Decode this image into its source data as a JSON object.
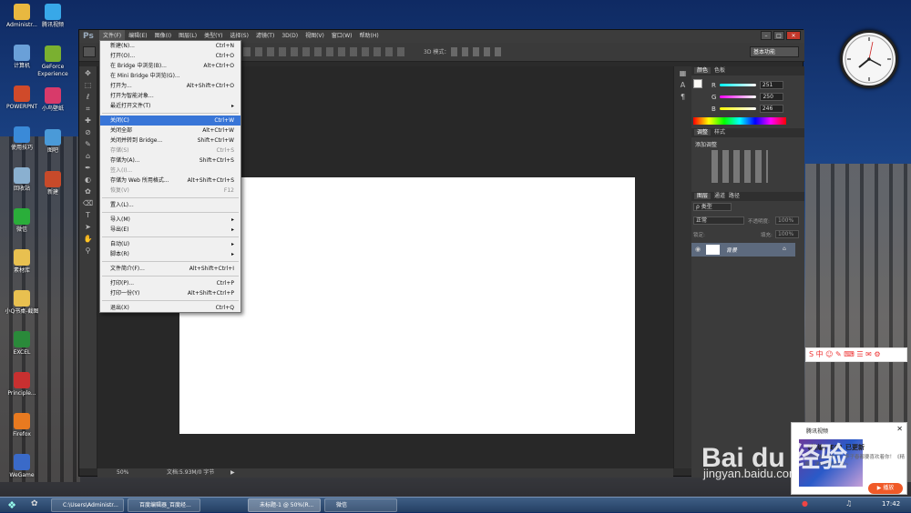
{
  "desktop": {
    "icons": [
      {
        "label": "Administr...",
        "color": "#e8b840"
      },
      {
        "label": "计算机",
        "color": "#6aa0d8"
      },
      {
        "label": "POWERPNT",
        "color": "#d04a2a"
      },
      {
        "label": "使用技巧",
        "color": "#3a8ad8"
      },
      {
        "label": "回收站",
        "color": "#8ab0d0"
      },
      {
        "label": "微信",
        "color": "#2aae3a"
      },
      {
        "label": "素材库",
        "color": "#e8c050"
      },
      {
        "label": "小Q书桌-截图",
        "color": "#e8c050"
      },
      {
        "label": "EXCEL",
        "color": "#2a8a3a"
      },
      {
        "label": "Principle...",
        "color": "#c83030"
      },
      {
        "label": "Firefox",
        "color": "#e87a20"
      },
      {
        "label": "WeGame",
        "color": "#3a6ac8"
      }
    ],
    "icons_col2": [
      {
        "label": "腾讯视频",
        "color": "#38a8e8"
      },
      {
        "label": "GeForce Experience",
        "color": "#7ab030"
      },
      {
        "label": "小鸟壁纸",
        "color": "#d83a6a"
      },
      {
        "label": "图吧",
        "color": "#4a9ad8"
      },
      {
        "label": "新建",
        "color": "#c84a2a"
      }
    ]
  },
  "ps": {
    "logo": "Ps",
    "menus": [
      "文件(F)",
      "编辑(E)",
      "图像(I)",
      "图层(L)",
      "类型(Y)",
      "选择(S)",
      "滤镜(T)",
      "3D(D)",
      "视图(V)",
      "窗口(W)",
      "帮助(H)"
    ],
    "workspace": "基本功能",
    "options_3d": "3D 模式：",
    "status_zoom": "50%",
    "status_doc": "文档:5.93M/0 字节",
    "panels": {
      "color_tabs": [
        "颜色",
        "色板"
      ],
      "rgb": [
        {
          "label": "R",
          "value": "251"
        },
        {
          "label": "G",
          "value": "250"
        },
        {
          "label": "B",
          "value": "246"
        }
      ],
      "adjust_tabs": [
        "调整",
        "样式"
      ],
      "adjust_title": "添加调整",
      "layers_tabs": [
        "图层",
        "通道",
        "路径"
      ],
      "layer_kind": "ρ 类型",
      "blend_mode": "正常",
      "opacity_label": "不透明度:",
      "opacity_value": "100%",
      "lock_label": "锁定:",
      "fill_label": "填充:",
      "fill_value": "100%",
      "layer_name": "背景"
    }
  },
  "file_menu": [
    {
      "label": "新建(N)...",
      "shortcut": "Ctrl+N"
    },
    {
      "label": "打开(O)...",
      "shortcut": "Ctrl+O"
    },
    {
      "label": "在 Bridge 中浏览(B)...",
      "shortcut": "Alt+Ctrl+O"
    },
    {
      "label": "在 Mini Bridge 中浏览(G)...",
      "shortcut": ""
    },
    {
      "label": "打开为...",
      "shortcut": "Alt+Shift+Ctrl+O"
    },
    {
      "label": "打开为智能对象...",
      "shortcut": ""
    },
    {
      "label": "最近打开文件(T)",
      "shortcut": "",
      "submenu": true
    },
    {
      "sep": true
    },
    {
      "label": "关闭(C)",
      "shortcut": "Ctrl+W",
      "highlight": true
    },
    {
      "label": "关闭全部",
      "shortcut": "Alt+Ctrl+W"
    },
    {
      "label": "关闭并转到 Bridge...",
      "shortcut": "Shift+Ctrl+W"
    },
    {
      "label": "存储(S)",
      "shortcut": "Ctrl+S",
      "disabled": true
    },
    {
      "label": "存储为(A)...",
      "shortcut": "Shift+Ctrl+S"
    },
    {
      "label": "签入(I)...",
      "shortcut": "",
      "disabled": true
    },
    {
      "label": "存储为 Web 所用格式...",
      "shortcut": "Alt+Shift+Ctrl+S"
    },
    {
      "label": "恢复(V)",
      "shortcut": "F12",
      "disabled": true
    },
    {
      "sep": true
    },
    {
      "label": "置入(L)...",
      "shortcut": ""
    },
    {
      "sep": true
    },
    {
      "label": "导入(M)",
      "shortcut": "",
      "submenu": true
    },
    {
      "label": "导出(E)",
      "shortcut": "",
      "submenu": true
    },
    {
      "sep": true
    },
    {
      "label": "自动(U)",
      "shortcut": "",
      "submenu": true
    },
    {
      "label": "脚本(R)",
      "shortcut": "",
      "submenu": true
    },
    {
      "sep": true
    },
    {
      "label": "文件简介(F)...",
      "shortcut": "Alt+Shift+Ctrl+I"
    },
    {
      "sep": true
    },
    {
      "label": "打印(P)...",
      "shortcut": "Ctrl+P"
    },
    {
      "label": "打印一份(Y)",
      "shortcut": "Alt+Shift+Ctrl+P"
    },
    {
      "sep": true
    },
    {
      "label": "退出(X)",
      "shortcut": "Ctrl+Q"
    }
  ],
  "taskbar": {
    "buttons": [
      "C:\\Users\\Administr...",
      "百度编辑器_百度经...",
      "未标题-1 @ 50%(R...",
      "微信"
    ],
    "time": "17:42"
  },
  "notify": {
    "app": "腾讯视频",
    "title": "《精编》E01 已更新",
    "body": "爱你就给你看大！李子春都要喜欢着你！《精编》详情精彩回放~",
    "action": "▶ 播放"
  },
  "watermark": "Bai du 经验",
  "watermark_url": "jingyan.baidu.com"
}
